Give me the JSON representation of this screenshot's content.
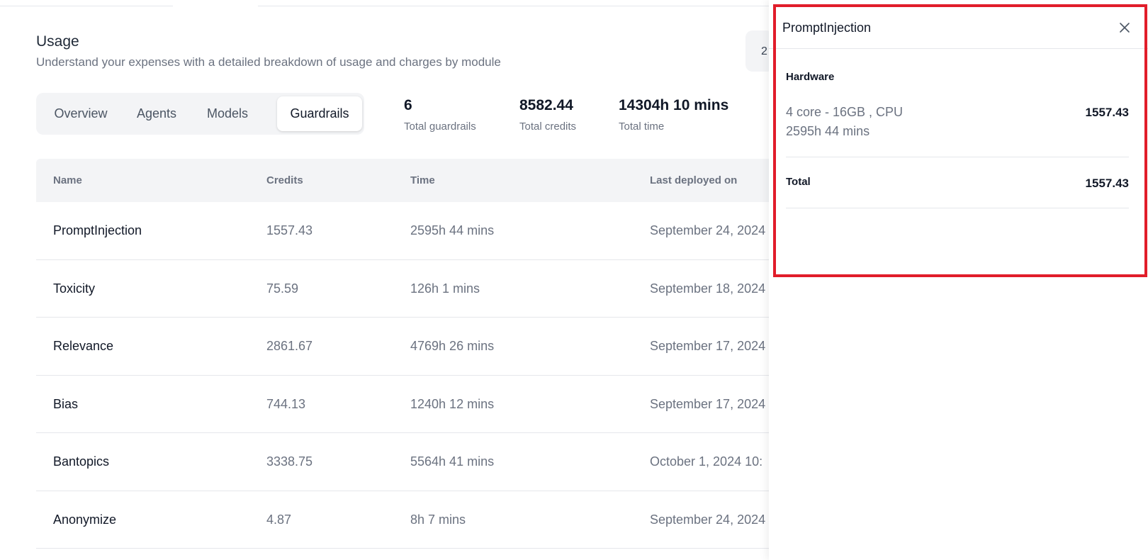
{
  "header": {
    "title": "Usage",
    "subtitle": "Understand your expenses with a detailed breakdown of usage and charges by module",
    "date_fragment": "2"
  },
  "tabs": [
    {
      "label": "Overview",
      "active": false
    },
    {
      "label": "Agents",
      "active": false
    },
    {
      "label": "Models",
      "active": false
    },
    {
      "label": "Guardrails",
      "active": true
    }
  ],
  "stats": [
    {
      "value": "6",
      "label": "Total guardrails"
    },
    {
      "value": "8582.44",
      "label": "Total credits"
    },
    {
      "value": "14304h 10 mins",
      "label": "Total time"
    }
  ],
  "table": {
    "columns": [
      "Name",
      "Credits",
      "Time",
      "Last deployed on"
    ],
    "rows": [
      {
        "name": "PromptInjection",
        "credits": "1557.43",
        "time": "2595h 44 mins",
        "deployed": "September 24, 2024"
      },
      {
        "name": "Toxicity",
        "credits": "75.59",
        "time": "126h 1 mins",
        "deployed": "September 18, 2024"
      },
      {
        "name": "Relevance",
        "credits": "2861.67",
        "time": "4769h 26 mins",
        "deployed": "September 17, 2024"
      },
      {
        "name": "Bias",
        "credits": "744.13",
        "time": "1240h 12 mins",
        "deployed": "September 17, 2024"
      },
      {
        "name": "Bantopics",
        "credits": "3338.75",
        "time": "5564h 41 mins",
        "deployed": "October 1, 2024 10:"
      },
      {
        "name": "Anonymize",
        "credits": "4.87",
        "time": "8h 7 mins",
        "deployed": "September 24, 2024"
      }
    ]
  },
  "drawer": {
    "title": "PromptInjection",
    "section_title": "Hardware",
    "hardware": {
      "spec": "4 core - 16GB , CPU",
      "time": "2595h 44 mins",
      "credits": "1557.43"
    },
    "total_label": "Total",
    "total_value": "1557.43",
    "highlight_color": "#e11d2a",
    "close_icon": "close-icon"
  }
}
